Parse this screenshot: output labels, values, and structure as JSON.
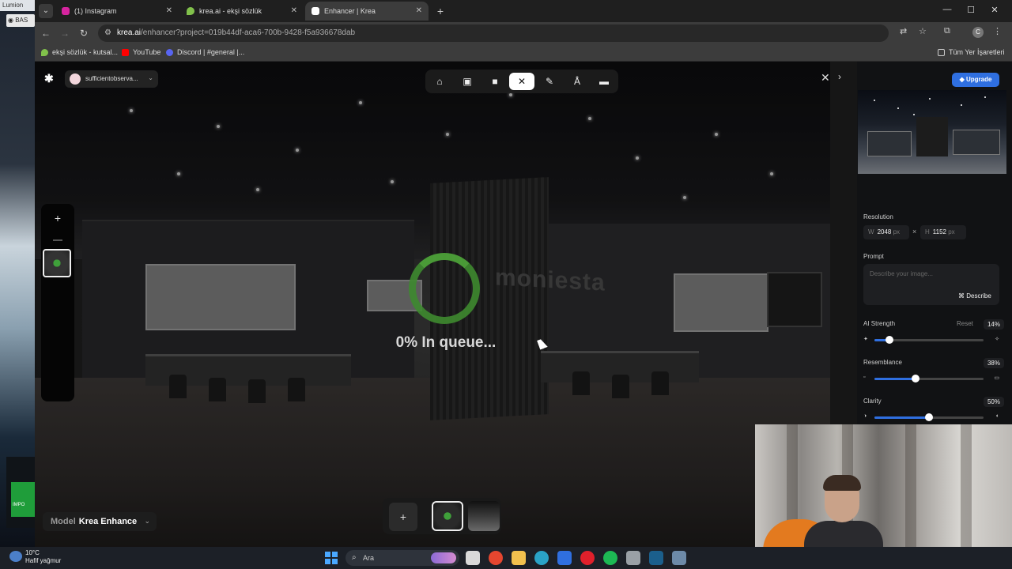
{
  "desktop": {
    "top_label": "Lumion",
    "bas_label": "BAS",
    "import_label": "IMPO"
  },
  "browser": {
    "tabs": [
      {
        "label": "(1) Instagram",
        "icon_color": "#d6249f"
      },
      {
        "label": "krea.ai - ekşi sözlük",
        "icon_color": "#81c14b"
      },
      {
        "label": "Enhancer | Krea",
        "icon_color": "#ffffff"
      }
    ],
    "url_host": "krea.ai",
    "url_rest": "/enhancer?project=019b44df-aca6-700b-9428-f5a936678dab",
    "profile_initial": "C",
    "bookmarks": [
      {
        "label": "ekşi sözlük - kutsal...",
        "icon_color": "#81c14b"
      },
      {
        "label": "YouTube",
        "icon_color": "#ff0000"
      },
      {
        "label": "Discord | #general |...",
        "icon_color": "#5865f2"
      }
    ],
    "all_bookmarks_label": "Tüm Yer İşaretleri"
  },
  "krea": {
    "workspace_name": "sufficientobserva...",
    "tools": [
      "home-icon",
      "image-icon",
      "video-icon",
      "enhance-icon",
      "edit-icon",
      "text-icon",
      "folder-icon"
    ],
    "selected_tool": "enhance-icon",
    "progress_percent": 0,
    "progress_text": "0% In queue...",
    "model_label": "Model",
    "model_value": "Krea Enhance",
    "upgrade_label": "Upgrade",
    "settings": {
      "resolution_label": "Resolution",
      "width_prefix": "W",
      "width_value": "2048",
      "height_prefix": "H",
      "height_value": "1152",
      "unit": "px",
      "times": "×",
      "prompt_label": "Prompt",
      "prompt_placeholder": "Describe your image...",
      "describe_label": "Describe",
      "ai_strength_label": "AI Strength",
      "reset_label": "Reset",
      "ai_strength_value": "14%",
      "ai_strength": 0.14,
      "resemblance_label": "Resemblance",
      "resemblance_value": "38%",
      "resemblance": 0.38,
      "clarity_label": "Clarity",
      "clarity_value": "50%",
      "clarity": 0.5
    },
    "scene_logo_text": "moniesta"
  },
  "taskbar": {
    "temperature": "10°C",
    "weather": "Hafif yağmur",
    "search_placeholder": "Ara",
    "apps": [
      {
        "name": "task-view-icon",
        "color": "#d9d9d9"
      },
      {
        "name": "chrome-icon",
        "color": "#e5462f"
      },
      {
        "name": "explorer-icon",
        "color": "#f2c14e"
      },
      {
        "name": "edge-icon",
        "color": "#2aa3c7"
      },
      {
        "name": "mail-icon",
        "color": "#2f6fe0"
      },
      {
        "name": "opera-icon",
        "color": "#e0202b"
      },
      {
        "name": "spotify-icon",
        "color": "#1db954"
      },
      {
        "name": "app-icon",
        "color": "#9aa0a6"
      },
      {
        "name": "steam-icon",
        "color": "#1b5f8c"
      },
      {
        "name": "calculator-icon",
        "color": "#6d8aa8"
      }
    ]
  }
}
